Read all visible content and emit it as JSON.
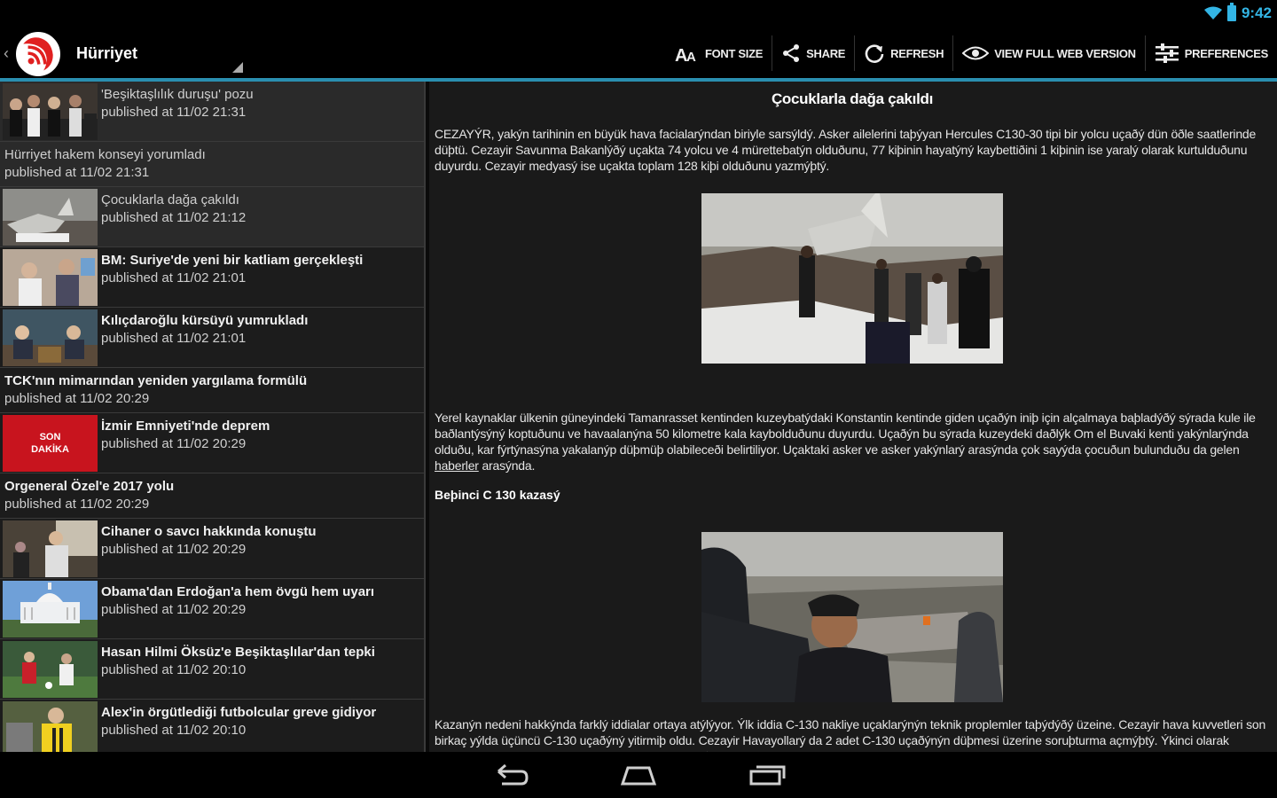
{
  "status": {
    "time": "9:42"
  },
  "appbar": {
    "title": "Hürriyet",
    "actions": [
      {
        "icon": "font-size-icon",
        "label": "FONT SIZE"
      },
      {
        "icon": "share-icon",
        "label": "SHARE"
      },
      {
        "icon": "refresh-icon",
        "label": "REFRESH"
      },
      {
        "icon": "eye-icon",
        "label": "VIEW FULL WEB VERSION"
      },
      {
        "icon": "sliders-icon",
        "label": "PREFERENCES"
      }
    ]
  },
  "list": [
    {
      "title": "'Beşiktaşlılık duruşu' pozu",
      "date": "published at 11/02 21:31",
      "thumb": "crowd",
      "light": true,
      "selected": true
    },
    {
      "title": "Hürriyet hakem konseyi yorumladı",
      "date": "published at 11/02 21:31",
      "thumb": null,
      "light": true,
      "selected": true
    },
    {
      "title": "Çocuklarla dağa çakıldı",
      "date": "published at 11/02 21:12",
      "thumb": "wreck",
      "light": true,
      "selected": true
    },
    {
      "title": "BM: Suriye'de yeni bir katliam gerçekleşti",
      "date": "published at 11/02 21:01",
      "thumb": "people",
      "light": false
    },
    {
      "title": "Kılıçdaroğlu kürsüyü yumrukladı",
      "date": "published at 11/02 21:01",
      "thumb": "speaker",
      "light": false
    },
    {
      "title": "TCK'nın mimarından yeniden yargılama formülü",
      "date": "published at 11/02 20:29",
      "thumb": null,
      "light": false
    },
    {
      "title": "İzmir Emniyeti'nde deprem",
      "date": "published at 11/02 20:29",
      "thumb": "sondakika",
      "light": false
    },
    {
      "title": "Orgeneral Özel'e 2017 yolu",
      "date": "published at 11/02 20:29",
      "thumb": null,
      "light": false
    },
    {
      "title": "Cihaner o savcı hakkında konuştu",
      "date": "published at 11/02 20:29",
      "thumb": "man",
      "light": false
    },
    {
      "title": "Obama'dan Erdoğan'a hem övgü hem uyarı",
      "date": "published at 11/02 20:29",
      "thumb": "capitol",
      "light": false
    },
    {
      "title": "Hasan Hilmi Öksüz'e Beşiktaşlılar'dan tepki",
      "date": "published at 11/02 20:10",
      "thumb": "football",
      "light": false
    },
    {
      "title": "Alex'in örgütlediği futbolcular greve gidiyor",
      "date": "published at 11/02 20:10",
      "thumb": "player",
      "light": false
    }
  ],
  "son_dakika": {
    "line1": "SON",
    "line2": "DAKİKA"
  },
  "article": {
    "title": "Çocuklarla dağa çakıldı",
    "p1": "CEZAYÝR, yakýn tarihinin en büyük hava facialarýndan biriyle sarsýldý. Asker ailelerini taþýyan Hercules C130-30 tipi bir yolcu uçaðý dün öðle saatlerinde düþtü. Cezayir Savunma Bakanlýðý uçakta 74 yolcu ve 4 mürettebatýn olduðunu, 77 kiþinin hayatýný kaybettiðini 1 kiþinin ise yaralý olarak kurtulduðunu duyurdu. Cezayir medyasý ise uçakta toplam 128 kiþi olduðunu yazmýþtý.",
    "p2_a": "Yerel kaynaklar ülkenin güneyindeki Tamanrasset kentinden kuzeybatýdaki Konstantin kentinde giden uçaðýn iniþ için alçalmaya baþladýðý sýrada kule ile baðlantýsýný koptuðunu ve havaalanýna 50 kilometre kala kaybolduðunu duyurdu. Uçaðýn bu sýrada kuzeydeki daðlýk Om el Buvaki kenti yakýnlarýnda olduðu, kar fýrtýnasýna yakalanýp düþmüþ olabileceði belirtiliyor. Uçaktaki asker ve asker yakýnlarý arasýnda çok sayýda çocuðun bulunduðu da gelen ",
    "p2_link": "haberler",
    "p2_b": " arasýnda.",
    "subheading": "Beþinci C 130 kazasý",
    "p3": "Kazanýn nedeni hakkýnda farklý iddialar ortaya atýlýyor. Ýlk iddia C-130 nakliye uçaklarýnýn teknik proplemler taþýdýðý üzeine. Cezayir hava kuvvetleri son birkaç yýlda üçüncü C-130 uçaðýný yitirmiþ oldu. Cezayir Havayollarý da 2 adet C-130 uçaðýnýn düþmesi üzerine soruþturma açmýþtý. Ýkinci olarak Konstantin Havaalanýnýn yerleþiminde kusur olduðu kaydediliyor."
  }
}
